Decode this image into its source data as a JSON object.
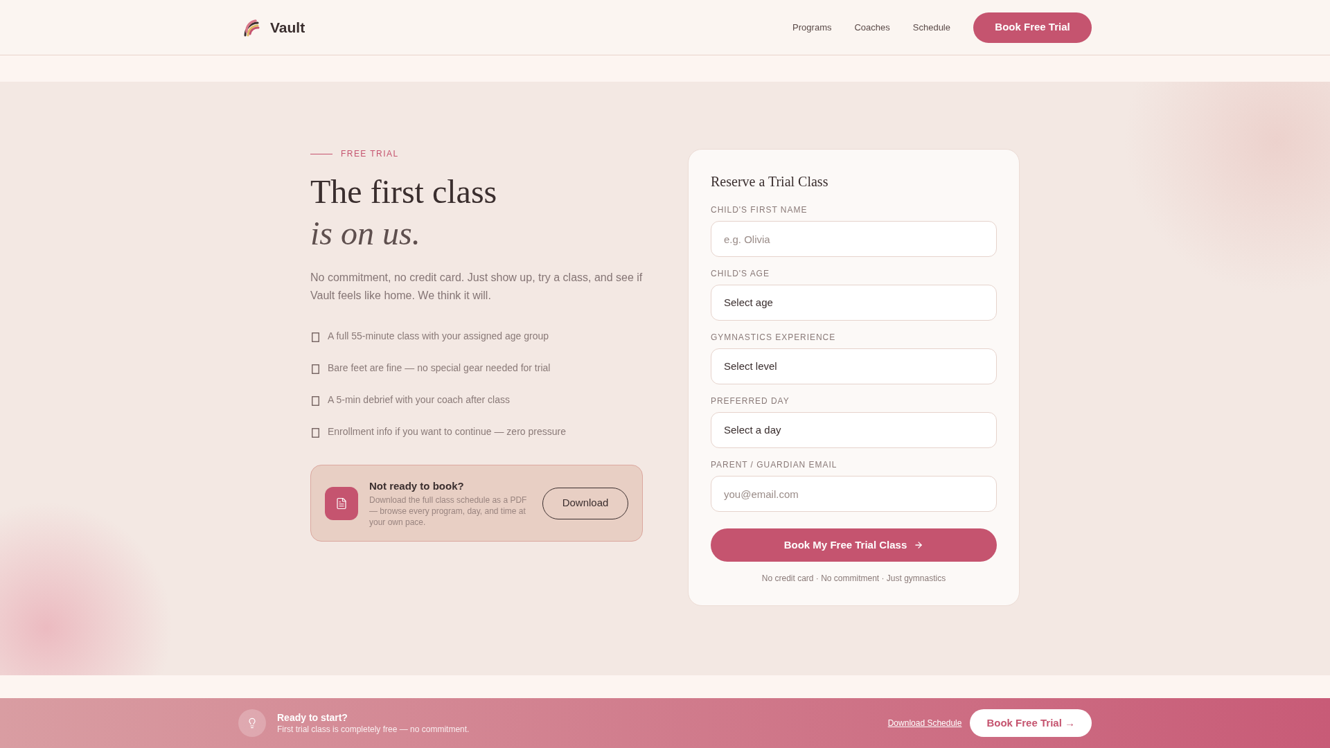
{
  "header": {
    "brand": "Vault",
    "nav": [
      "Programs",
      "Coaches",
      "Schedule"
    ],
    "cta": "Book Free Trial"
  },
  "hero": {
    "eyebrow": "FREE TRIAL",
    "title_line_1": "The first class",
    "title_line_2": "is on us.",
    "intro": "No commitment, no credit card. Just show up, try a class, and see if Vault feels like home. We think it will.",
    "perks": [
      "A full 55-minute class with your assigned age group",
      "Bare feet are fine — no special gear needed for trial",
      "A 5-min debrief with your coach after class",
      "Enrollment info if you want to continue — zero pressure"
    ],
    "download_card": {
      "title": "Not ready to book?",
      "text": "Download the full class schedule as a PDF — browse every program, day, and time at your own pace.",
      "button": "Download"
    }
  },
  "form": {
    "title": "Reserve a Trial Class",
    "fields": [
      {
        "kind": "text",
        "label": "CHILD'S FIRST NAME",
        "placeholder": "e.g. Olivia"
      },
      {
        "kind": "select",
        "label": "CHILD'S AGE",
        "value": "Select age"
      },
      {
        "kind": "select",
        "label": "GYMNASTICS EXPERIENCE",
        "value": "Select level"
      },
      {
        "kind": "select",
        "label": "PREFERRED DAY",
        "value": "Select a day"
      },
      {
        "kind": "email",
        "label": "PARENT / GUARDIAN EMAIL",
        "placeholder": "you@email.com"
      }
    ],
    "submit": "Book My Free Trial Class",
    "note": "No credit card · No commitment · Just gymnastics"
  },
  "banner": {
    "title": "Ready to start?",
    "text": "First trial class is completely free — no commitment.",
    "link": "Download Schedule",
    "button": "Book Free Trial →"
  }
}
